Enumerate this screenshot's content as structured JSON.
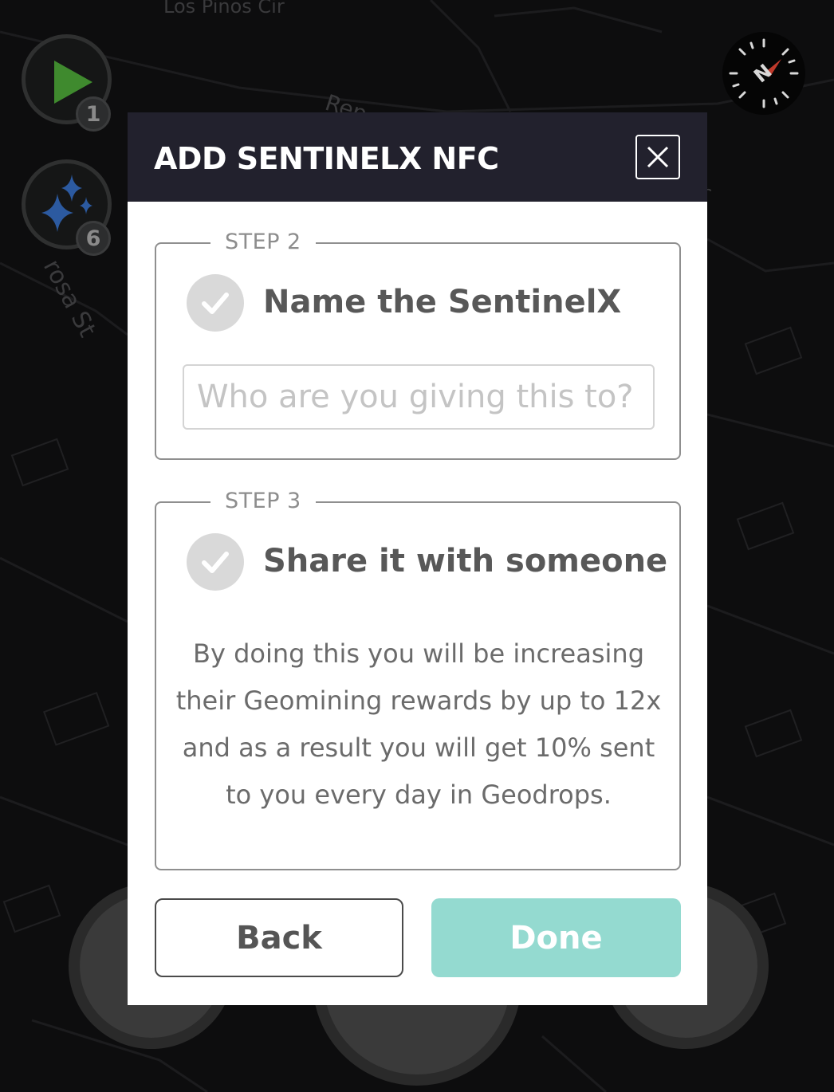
{
  "map": {
    "street_labels": [
      "Los Pinos Cir",
      "Rep",
      "rosa St",
      "r"
    ],
    "play_badge": "1",
    "sparkle_badge": "6",
    "compass_letter": "N"
  },
  "modal": {
    "title": "ADD SENTINELX NFC",
    "close_icon": "close-icon",
    "step2": {
      "label": "STEP 2",
      "title": "Name the SentinelX",
      "input_placeholder": "Who are you giving this to?",
      "input_value": ""
    },
    "step3": {
      "label": "STEP 3",
      "title": "Share it with someone",
      "description": "By doing this you will be increasing their Geomining rewards by up to 12x and as a result you will get 10% sent to you every day in Geodrops."
    },
    "back_label": "Back",
    "done_label": "Done"
  },
  "colors": {
    "header_bg": "#22212d",
    "done_bg": "#94dad0",
    "check_bg": "#d9d9d9",
    "map_bg": "#0d0d0e",
    "play_icon": "#3f8a2e",
    "sparkle_icon": "#2c5aa0",
    "compass_needle": "#c0392b"
  }
}
